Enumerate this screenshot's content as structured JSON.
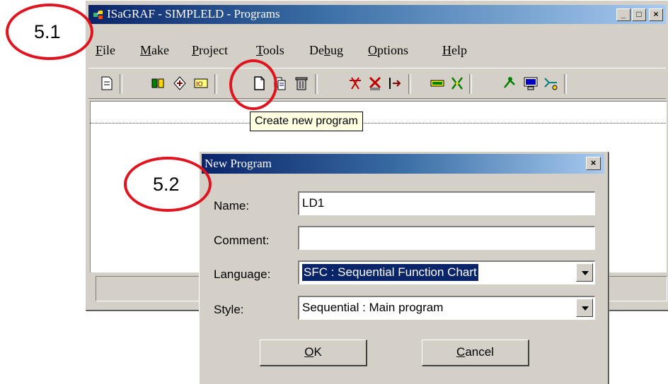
{
  "main_window": {
    "title": "ISaGRAF - SIMPLELD - Programs",
    "controls": {
      "minimize": "_",
      "maximize": "□",
      "close": "×"
    }
  },
  "menu": [
    {
      "label": "File",
      "accel": "F"
    },
    {
      "label": "Make",
      "accel": "M"
    },
    {
      "label": "Project",
      "accel": "P"
    },
    {
      "label": "Tools",
      "accel": "T"
    },
    {
      "label": "Debug",
      "accel": "b"
    },
    {
      "label": "Options",
      "accel": "O"
    },
    {
      "label": "Help",
      "accel": "H"
    }
  ],
  "toolbar_icons": [
    "properties-icon",
    "make-application-icon",
    "link-icon",
    "variables-icon",
    "new-program-icon",
    "copy-program-icon",
    "delete-program-icon",
    "simulate-icon",
    "verify-icon",
    "download-icon",
    "io-connection-icon",
    "io-settings-icon",
    "debug-icon",
    "monitor-icon",
    "communication-icon"
  ],
  "tooltip": "Create new program",
  "callouts": {
    "first": "5.1",
    "second": "5.2",
    "color": "#e0141e"
  },
  "dialog": {
    "title": "New Program",
    "close": "×",
    "name_label": "Name:",
    "name_value": "LD1",
    "comment_label": "Comment:",
    "comment_value": "",
    "language_label": "Language:",
    "language_value": "SFC : Sequential Function Chart",
    "style_label": "Style:",
    "style_value": "Sequential : Main program",
    "ok": {
      "label": "OK",
      "accel": "O"
    },
    "cancel": {
      "label": "Cancel",
      "accel": "C"
    }
  }
}
